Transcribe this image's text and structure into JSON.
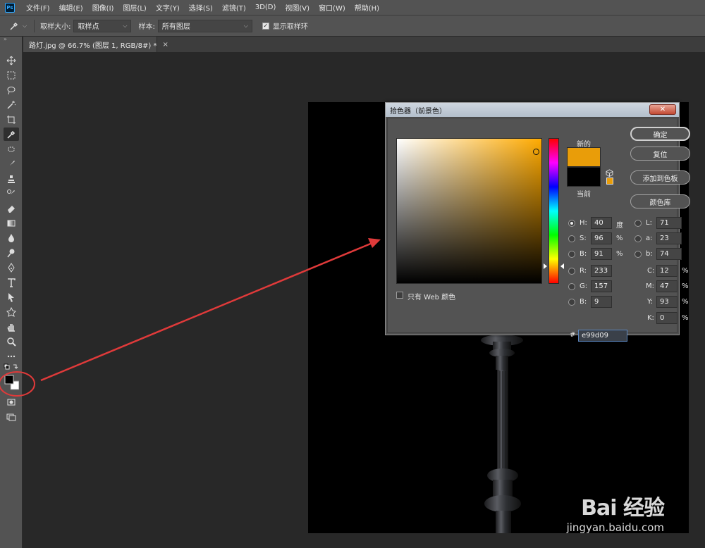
{
  "app": {
    "logo": "Ps"
  },
  "menu": [
    "文件(F)",
    "编辑(E)",
    "图像(I)",
    "图层(L)",
    "文字(Y)",
    "选择(S)",
    "滤镜(T)",
    "3D(D)",
    "视图(V)",
    "窗口(W)",
    "帮助(H)"
  ],
  "options": {
    "sample_size_label": "取样大小:",
    "sample_size_value": "取样点",
    "sample_label": "样本:",
    "sample_value": "所有图层",
    "show_ring_label": "显示取样环",
    "show_ring_checked": true
  },
  "document": {
    "tab_title": "路灯.jpg @ 66.7% (图层 1, RGB/8#) *",
    "close": "×"
  },
  "picker": {
    "title": "拾色器（前景色）",
    "close": "✕",
    "new_label": "新的",
    "current_label": "当前",
    "new_color": "#e99d09",
    "current_color": "#000000",
    "buttons": {
      "ok": "确定",
      "reset": "复位",
      "add_swatch": "添加到色板",
      "libraries": "颜色库"
    },
    "web_only_label": "只有 Web 颜色",
    "hsb": {
      "h": {
        "label": "H:",
        "value": "40",
        "unit": "度"
      },
      "s": {
        "label": "S:",
        "value": "96",
        "unit": "%"
      },
      "b": {
        "label": "B:",
        "value": "91",
        "unit": "%"
      }
    },
    "rgb": {
      "r": {
        "label": "R:",
        "value": "233"
      },
      "g": {
        "label": "G:",
        "value": "157"
      },
      "b": {
        "label": "B:",
        "value": "9"
      }
    },
    "lab": {
      "l": {
        "label": "L:",
        "value": "71"
      },
      "a": {
        "label": "a:",
        "value": "23"
      },
      "b": {
        "label": "b:",
        "value": "74"
      }
    },
    "cmyk": {
      "c": {
        "label": "C:",
        "value": "12",
        "unit": "%"
      },
      "m": {
        "label": "M:",
        "value": "47",
        "unit": "%"
      },
      "y": {
        "label": "Y:",
        "value": "93",
        "unit": "%"
      },
      "k": {
        "label": "K:",
        "value": "0",
        "unit": "%"
      }
    },
    "hex_label": "#",
    "hex_value": "e99d09"
  },
  "watermark": {
    "main": "Bai 经验",
    "sub": "jingyan.baidu.com"
  },
  "colors": {
    "foreground": "#000000",
    "background": "#ffffff",
    "annotation": "#e03a3a"
  }
}
